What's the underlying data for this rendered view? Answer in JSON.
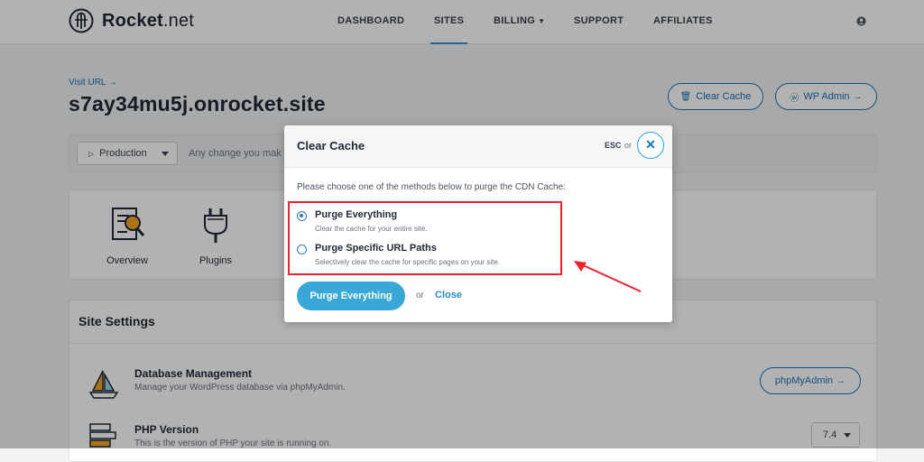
{
  "app": {
    "logo_bold": "Rocket",
    "logo_light": ".net"
  },
  "nav": {
    "items": [
      {
        "label": "DASHBOARD"
      },
      {
        "label": "SITES"
      },
      {
        "label": "BILLING"
      },
      {
        "label": "SUPPORT"
      },
      {
        "label": "AFFILIATES"
      }
    ],
    "active": "SITES",
    "user_icon": "user-icon"
  },
  "site": {
    "visit_url": "Visit URL →",
    "domain": "s7ay34mu5j.onrocket.site",
    "clear_cache_label": "Clear Cache",
    "wp_admin_label": "WP Admin →"
  },
  "environment": {
    "selected": "Production",
    "note": "Any change you mak"
  },
  "tools": [
    {
      "label": "Overview",
      "icon": "overview-icon"
    },
    {
      "label": "Plugins",
      "icon": "plugin-icon"
    }
  ],
  "settings": {
    "title": "Site Settings",
    "rows": [
      {
        "name": "Database Management",
        "desc": "Manage your WordPress database via phpMyAdmin.",
        "action": "phpMyAdmin →"
      },
      {
        "name": "PHP Version",
        "desc": "This is the version of PHP your site is running on.",
        "value": "7.4"
      }
    ]
  },
  "modal": {
    "title": "Clear Cache",
    "esc": "ESC",
    "or": "or",
    "prompt": "Please choose one of the methods below to purge the CDN Cache:",
    "options": [
      {
        "title": "Purge Everything",
        "desc": "Clear the cache for your entire site.",
        "checked": true
      },
      {
        "title": "Purge Specific URL Paths",
        "desc": "Selectively clear the cache for specific pages on your site.",
        "checked": false
      }
    ],
    "primary_label": "Purge Everything",
    "or2": "or",
    "close_label": "Close"
  },
  "colors": {
    "accent": "#3aa8d6",
    "link": "#1a73b5",
    "highlight": "#e8232e"
  }
}
